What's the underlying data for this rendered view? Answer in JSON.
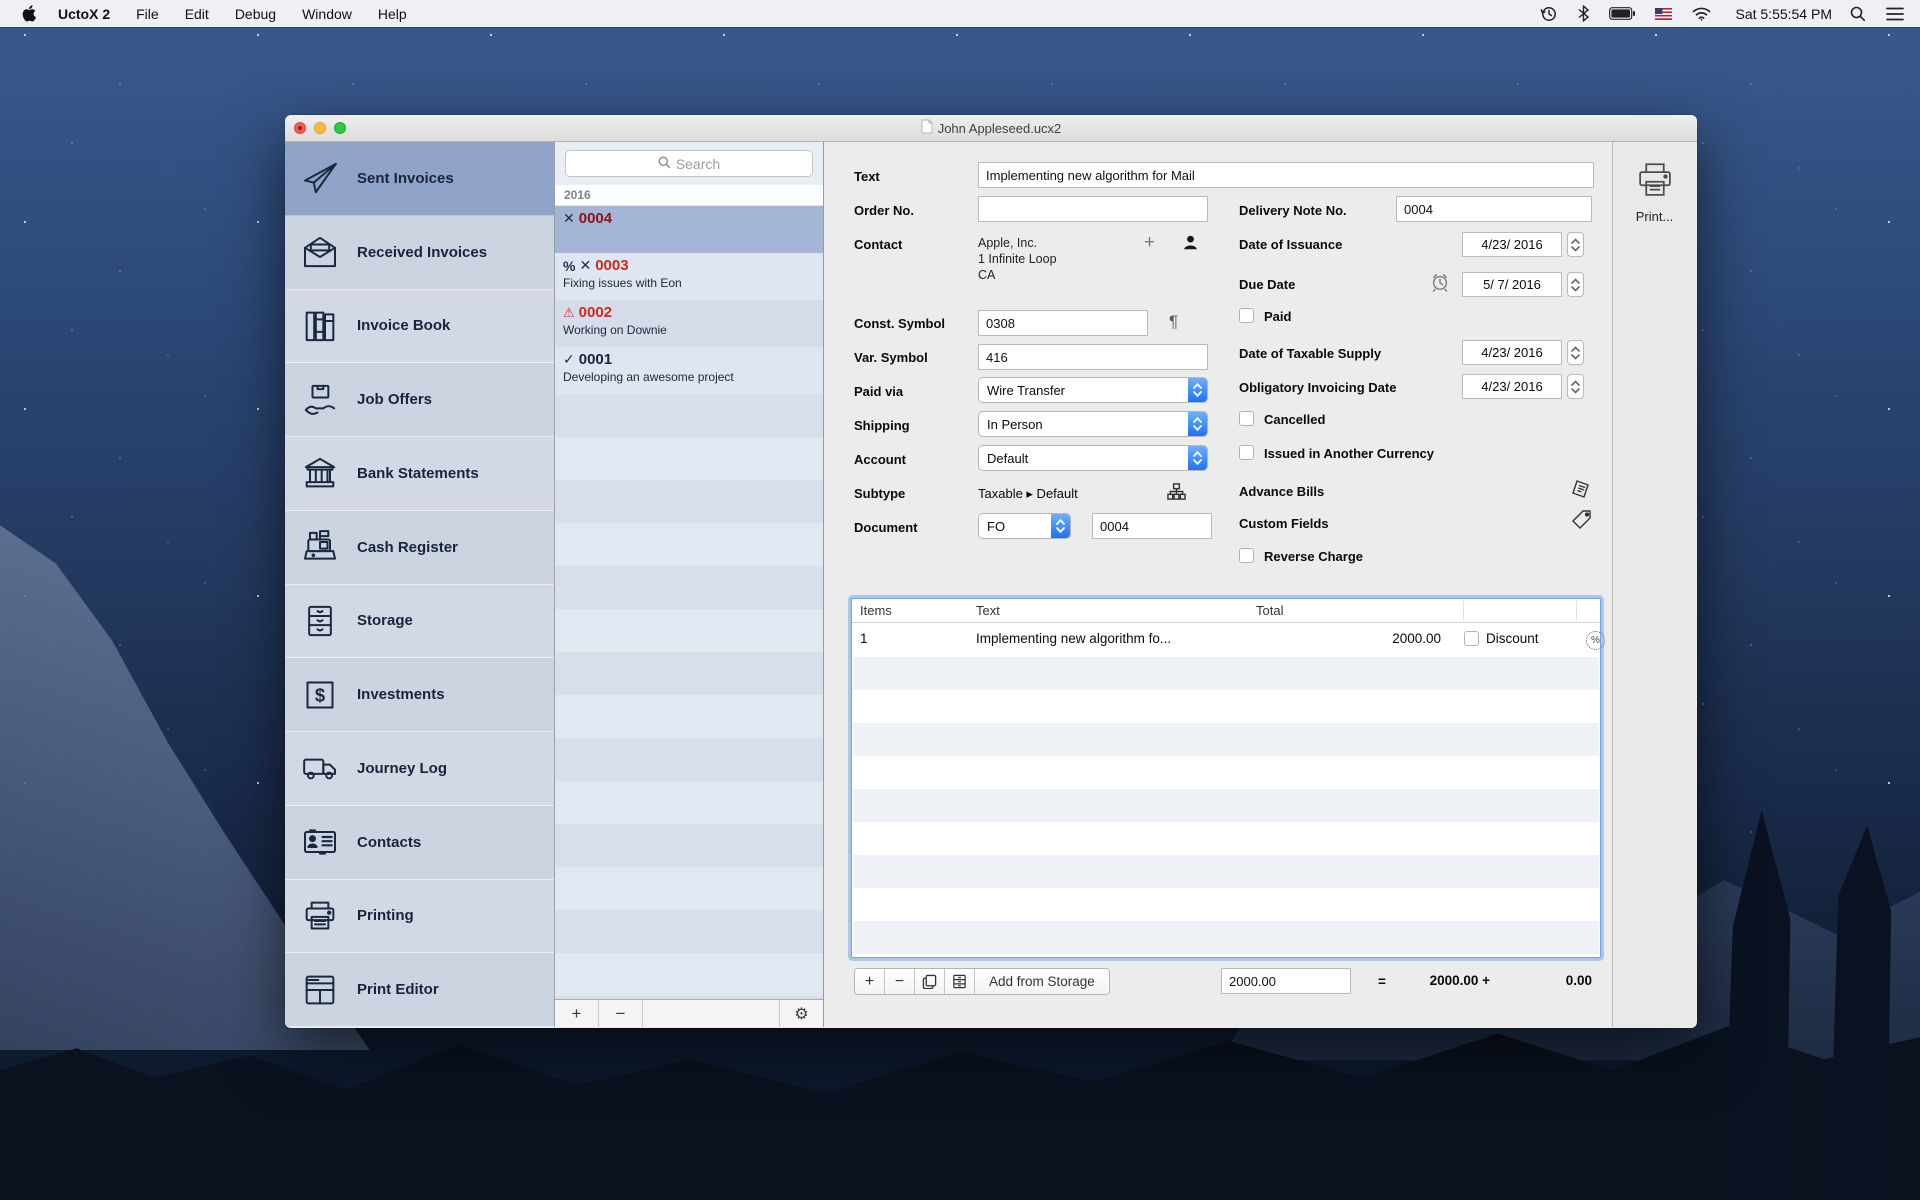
{
  "menu_bar": {
    "app_name": "UctoX 2",
    "menus": [
      "File",
      "Edit",
      "Debug",
      "Window",
      "Help"
    ],
    "clock": "Sat 5:55:54 PM"
  },
  "window": {
    "title": "John Appleseed.ucx2"
  },
  "sidebar": {
    "items": [
      {
        "label": "Sent Invoices",
        "selected": true
      },
      {
        "label": "Received Invoices"
      },
      {
        "label": "Invoice Book"
      },
      {
        "label": "Job Offers"
      },
      {
        "label": "Bank Statements"
      },
      {
        "label": "Cash Register"
      },
      {
        "label": "Storage"
      },
      {
        "label": "Investments"
      },
      {
        "label": "Journey Log"
      },
      {
        "label": "Contacts"
      },
      {
        "label": "Printing"
      },
      {
        "label": "Print Editor"
      }
    ]
  },
  "invoice_list": {
    "search_placeholder": "Search",
    "group": "2016",
    "items": [
      {
        "number": "0004",
        "subtitle": "",
        "selected": true
      },
      {
        "number": "0003",
        "subtitle": "Fixing issues with Eon"
      },
      {
        "number": "0002",
        "subtitle": "Working on Downie"
      },
      {
        "number": "0001",
        "subtitle": "Developing an awesome project"
      }
    ]
  },
  "form": {
    "text": {
      "label": "Text",
      "value": "Implementing new algorithm for Mail"
    },
    "order_no": {
      "label": "Order No.",
      "value": ""
    },
    "contact": {
      "label": "Contact",
      "lines": [
        "Apple, Inc.",
        "1 Infinite Loop",
        "CA"
      ]
    },
    "const_symbol": {
      "label": "Const. Symbol",
      "value": "0308"
    },
    "var_symbol": {
      "label": "Var. Symbol",
      "value": "416"
    },
    "paid_via": {
      "label": "Paid via",
      "value": "Wire Transfer"
    },
    "shipping": {
      "label": "Shipping",
      "value": "In Person"
    },
    "account": {
      "label": "Account",
      "value": "Default"
    },
    "subtype": {
      "label": "Subtype",
      "value": "Taxable ▸ Default"
    },
    "document": {
      "label": "Document",
      "type": "FO",
      "number": "0004"
    },
    "delivery_note_no": {
      "label": "Delivery Note No.",
      "value": "0004"
    },
    "date_of_issuance": {
      "label": "Date of Issuance",
      "value": "4/23/ 2016"
    },
    "due_date": {
      "label": "Due Date",
      "value": "5/ 7/ 2016"
    },
    "paid": {
      "label": "Paid",
      "checked": false
    },
    "date_of_taxable_supply": {
      "label": "Date of Taxable Supply",
      "value": "4/23/ 2016"
    },
    "obligatory_invoicing_date": {
      "label": "Obligatory Invoicing Date",
      "value": "4/23/ 2016"
    },
    "cancelled": {
      "label": "Cancelled",
      "checked": false
    },
    "issued_in_another_currency": {
      "label": "Issued in Another Currency",
      "checked": false
    },
    "advance_bills": {
      "label": "Advance Bills"
    },
    "custom_fields": {
      "label": "Custom Fields"
    },
    "reverse_charge": {
      "label": "Reverse Charge",
      "checked": false
    }
  },
  "items_table": {
    "headers": [
      "Items",
      "Text",
      "Total"
    ],
    "rows": [
      {
        "items": "1",
        "text": "Implementing new algorithm fo...",
        "total": "2000.00",
        "discount_label": "Discount"
      }
    ]
  },
  "items_footer": {
    "add_from_storage": "Add from Storage",
    "amount_input": "2000.00",
    "equals": "=",
    "subtotal": "2000.00 +",
    "tax": "0.00"
  },
  "print": {
    "label": "Print..."
  },
  "colors": {
    "accent_blue": "#2f7cf4",
    "sidebar_selected": "#90a4c9",
    "list_selected": "#a4b6d8",
    "invoice_red": "#d0281e",
    "invoice_dark_red": "#8e1414",
    "panel_gray": "#ececec"
  }
}
